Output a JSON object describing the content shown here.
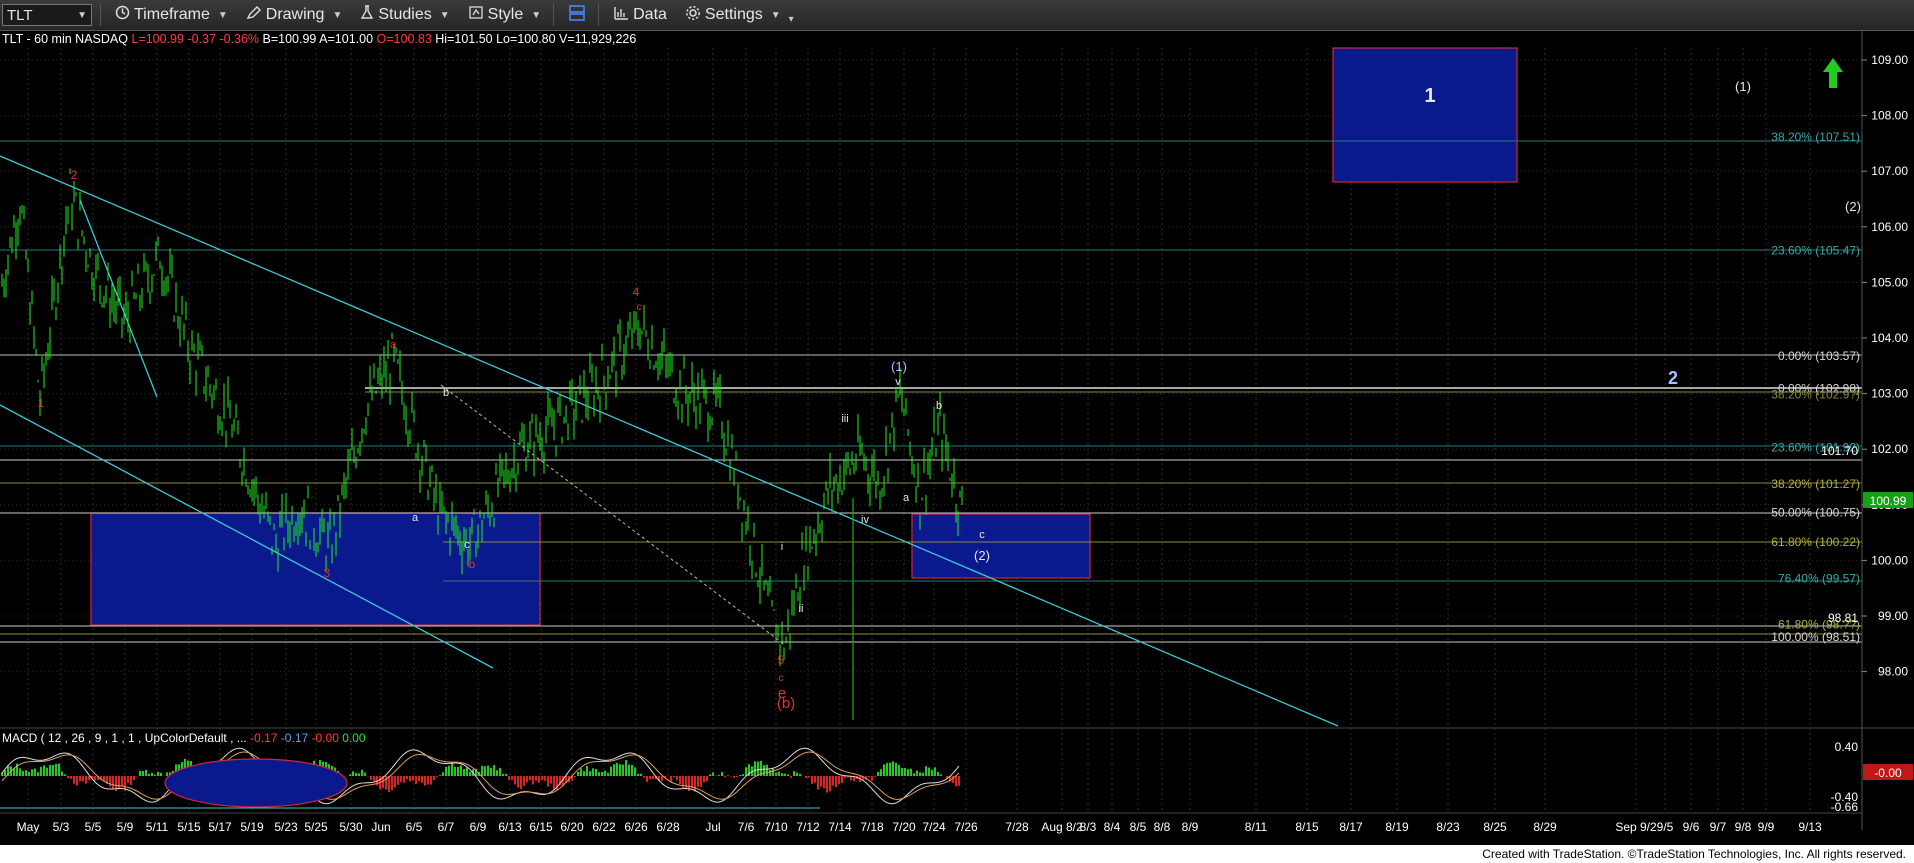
{
  "toolbar": {
    "symbol": "TLT",
    "timeframe": "Timeframe",
    "drawing": "Drawing",
    "studies": "Studies",
    "style": "Style",
    "data": "Data",
    "settings": "Settings"
  },
  "info": {
    "title": "TLT - 60 min  NASDAQ",
    "last": "L=100.99",
    "chg": "-0.37",
    "pct": "-0.36%",
    "bid": "B=100.99",
    "ask": "A=101.00",
    "open": "O=100.83",
    "high": "Hi=101.50",
    "low": "Lo=100.80",
    "volume": "V=11,929,226"
  },
  "price_axis": {
    "ticks": [
      "109.00",
      "108.00",
      "107.00",
      "106.00",
      "105.00",
      "104.00",
      "103.00",
      "102.00",
      "101.00",
      "100.00",
      "99.00",
      "98.00"
    ],
    "last_price": "100.99",
    "marker_101_70": "101.70",
    "marker_98_81": "98.81"
  },
  "fib_labels": [
    {
      "text": "38.20% (107.51)",
      "price": 107.51,
      "color": "#3aa6a6"
    },
    {
      "text": "23.60% (105.47)",
      "price": 105.47,
      "color": "#3aa6a6"
    },
    {
      "text": "0.00% (103.57)",
      "price": 103.57,
      "color": "#d8d8d8"
    },
    {
      "text": "0.00% (102.98)",
      "price": 102.98,
      "color": "#d8d8d8"
    },
    {
      "text": "38.20% (102.9?)",
      "price": 102.88,
      "color": "#8a8a40"
    },
    {
      "text": "23.60% (101.92)",
      "price": 101.92,
      "color": "#3aa6a6"
    },
    {
      "text": "38.20% (101.27)",
      "price": 101.27,
      "color": "#b0b040"
    },
    {
      "text": "50.00% (100.75)",
      "price": 100.75,
      "color": "#d8d8d8"
    },
    {
      "text": "61.80% (100.22)",
      "price": 100.22,
      "color": "#b0b040"
    },
    {
      "text": "76.40% (99.57)",
      "price": 99.57,
      "color": "#3aa6a6"
    },
    {
      "text": "61.80% (98.??)",
      "price": 98.74,
      "color": "#b0b040"
    },
    {
      "text": "100.00% (98.51)",
      "price": 98.51,
      "color": "#d8d8d8"
    }
  ],
  "date_labels": [
    "May",
    "5/3",
    "5/5",
    "5/9",
    "5/11",
    "5/15",
    "5/17",
    "5/19",
    "5/23",
    "5/25",
    "5/30",
    "Jun",
    "6/5",
    "6/7",
    "6/9",
    "6/13",
    "6/15",
    "6/20",
    "6/22",
    "6/26",
    "6/28",
    "Jul",
    "7/6",
    "7/10",
    "7/12",
    "7/14",
    "7/18",
    "7/20",
    "7/24",
    "7/26",
    "7/28",
    "Aug 8/2",
    "8/3",
    "8/4",
    "8/5",
    "8/8",
    "8/9",
    "8/11",
    "8/15",
    "8/17",
    "8/19",
    "8/23",
    "8/25",
    "8/29",
    "Sep 9/2",
    "9/5",
    "9/6",
    "9/7",
    "9/8",
    "9/9",
    "9/13"
  ],
  "wave_labels": {
    "box1": "1",
    "box2": "2",
    "p1_paren": "(1)",
    "p2_paren": "(2)",
    "big1": "(1)",
    "big2": "(2)",
    "b_paren": "(b)",
    "e": "e",
    "iii": "iii",
    "iv": "iv",
    "i": "i",
    "ii": "ii",
    "v": "v",
    "a": "a",
    "b": "b",
    "c": "c",
    "n1": "1",
    "n2": "2",
    "n3": "3",
    "n4": "4",
    "n5": "5"
  },
  "macd": {
    "title": "MACD ( 12 , 26 , 9 , 1 , 1 , UpColorDefault , ...",
    "v1": "-0.17",
    "v2": "-0.17",
    "v3": "-0.00",
    "v4": "0.00",
    "ticks": [
      "0.40",
      "-0.40",
      "-0.66"
    ],
    "last": "-0.00"
  },
  "footer": "Created with TradeStation. ©TradeStation Technologies, Inc. All rights reserved.",
  "colors": {
    "candle": "#22ee22",
    "trendline": "#3cc8d8",
    "box_fill": "#0a1a8c",
    "box_border": "#d0243a",
    "wave_red": "#e03030",
    "wave_white": "#e8e8e8"
  }
}
